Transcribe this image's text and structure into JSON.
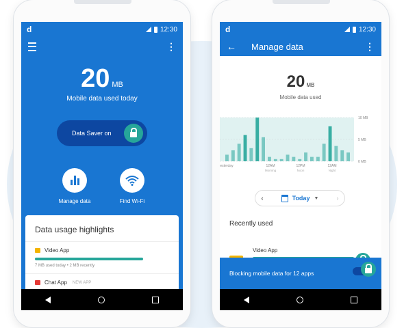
{
  "status_bar": {
    "time": "12:30"
  },
  "home_screen": {
    "usage_value": "20",
    "usage_unit": "MB",
    "usage_caption": "Mobile data used today",
    "data_saver_label": "Data Saver on",
    "actions": [
      {
        "label": "Manage data",
        "icon": "bar-chart-icon"
      },
      {
        "label": "Find Wi-Fi",
        "icon": "wifi-icon"
      }
    ],
    "highlights": {
      "title": "Data usage highlights",
      "apps": [
        {
          "name": "Video App",
          "meta": "7 MB used today • 2 MB recently",
          "color": "#f4b400"
        },
        {
          "name": "Chat App",
          "tag": "NEW APP",
          "color": "#e53935"
        }
      ]
    }
  },
  "manage_screen": {
    "title": "Manage data",
    "usage_value": "20",
    "usage_unit": "MB",
    "usage_caption": "Mobile data used",
    "day_selector": "Today",
    "recently_used_title": "Recently used",
    "recent_app": "Video App",
    "blocking_text": "Blocking mobile data for 12 apps"
  },
  "chart_data": {
    "type": "bar",
    "y_tick_labels": [
      "10 MB",
      "5 MB",
      "0 MB"
    ],
    "x_tick_labels": [
      {
        "time": "esterday",
        "sub": ""
      },
      {
        "time": "12AM",
        "sub": "Morning"
      },
      {
        "time": "12PM",
        "sub": "Noon"
      },
      {
        "time": "12AM",
        "sub": "Night"
      }
    ],
    "ylim": [
      0,
      10
    ],
    "values": [
      1.5,
      2.5,
      4,
      6,
      3,
      10,
      5.5,
      1,
      0.5,
      0.5,
      1.5,
      1,
      0.5,
      2,
      1,
      1,
      4,
      8,
      3.5,
      2.5,
      2
    ],
    "color": "#26a69a",
    "background": "#e0f2f1"
  },
  "colors": {
    "primary": "#1976d2",
    "primary_dark": "#0d47a1",
    "accent": "#26a69a"
  }
}
